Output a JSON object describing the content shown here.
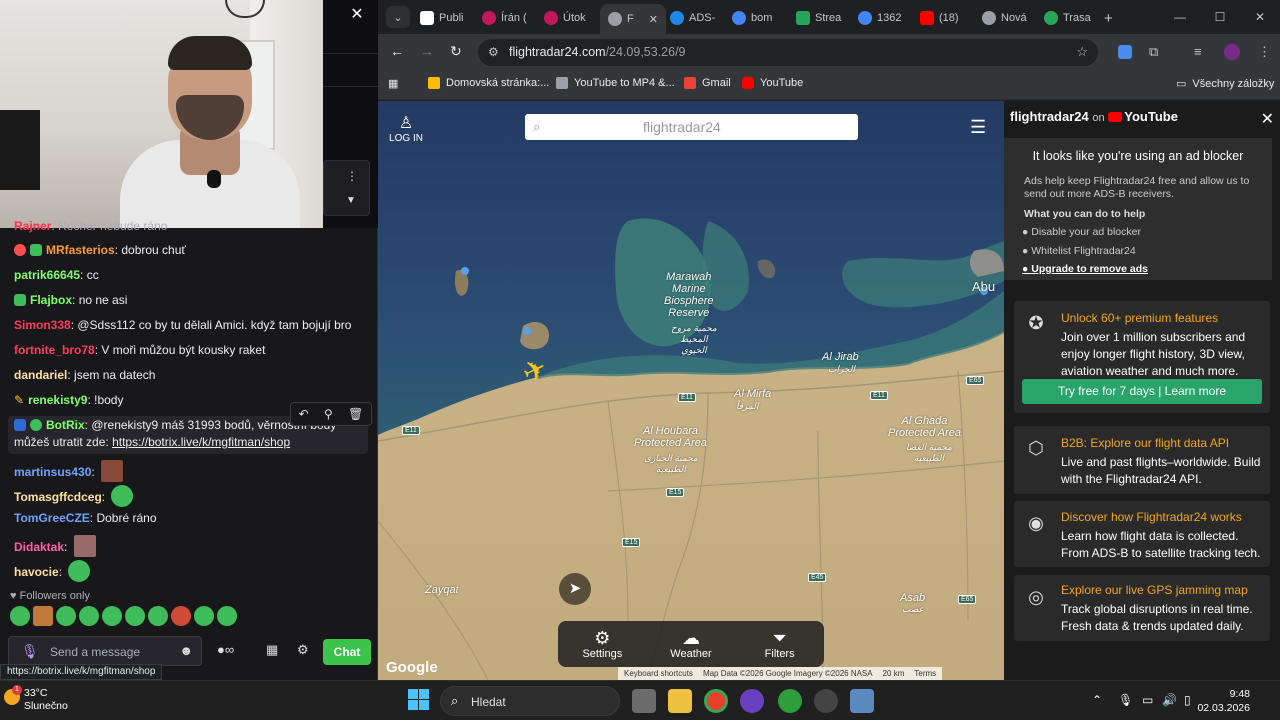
{
  "chat": {
    "close": "✕",
    "messages": [
      {
        "user": "MRfasterios",
        "color": "#ff7f00",
        "text": "dobrou chuť"
      },
      {
        "user": "patrik66645",
        "color": "#7fff00",
        "text": "cc"
      },
      {
        "user": "Flajbox",
        "color": "#7fff00",
        "text": "no ne asi"
      },
      {
        "user": "Simon338",
        "color": "#ff2f4f",
        "text": "@Sdss112 co by tu dělali Amici. když tam bojují bro"
      },
      {
        "user": "fortnite_bro78",
        "color": "#ff2f4f",
        "text": "V moři můžou být kousky raket"
      },
      {
        "user": "dandariel",
        "color": "#ffd59b",
        "text": "jsem na datech"
      },
      {
        "user": "renekisty9",
        "color": "#7fff00",
        "text": "!body"
      },
      {
        "user": "BotRix",
        "color": "#7fff00",
        "text": "@renekisty9 máš 31993 bodů, věrnostní body můžeš utratit zde:",
        "link": "https://botrix.live/k/mgfitman/shop"
      },
      {
        "user": "martinsus430",
        "color": "#5b9bff",
        "text": ""
      },
      {
        "user": "Tomasgffcdceg",
        "color": "#ffd59b",
        "text": ""
      },
      {
        "user": "TomGreeCZE",
        "color": "#5b9bff",
        "text": "Dobré ráno"
      },
      {
        "user": "Didaktak",
        "color": "#ff69b4",
        "text": ""
      },
      {
        "user": "havocie",
        "color": "#ffd59b",
        "text": ""
      }
    ],
    "partial_top": "Rocher nebude ráno",
    "followers_only": "Followers only",
    "input_placeholder": "Send a message",
    "chat_button": "Chat",
    "status_url": "https://botrix.live/k/mgfitman/shop"
  },
  "browser": {
    "tabs": [
      {
        "label": "Publi",
        "color": "#ffffff"
      },
      {
        "label": "Írán (",
        "color": "#c2185b"
      },
      {
        "label": "Útok",
        "color": "#c2185b"
      },
      {
        "label": "F",
        "color": "#9aa0a6",
        "active": true
      },
      {
        "label": "ADS-",
        "color": "#1e88e5"
      },
      {
        "label": "bom",
        "color": "#4285f4"
      },
      {
        "label": "Strea",
        "color": "#26a65b"
      },
      {
        "label": "1362",
        "color": "#4285f4"
      },
      {
        "label": "(18)",
        "color": "#ff0000"
      },
      {
        "label": "Nová",
        "color": "#9aa0a6"
      },
      {
        "label": "Trasa",
        "color": "#26a65b"
      }
    ],
    "url_host": "flightradar24.com",
    "url_path": "/24.09,53.26/9",
    "bookmarks": [
      {
        "label": "Domovská stránka:...",
        "color": "#fbbc05"
      },
      {
        "label": "YouTube to MP4 &...",
        "color": "#9aa0a6"
      },
      {
        "label": "Gmail",
        "color": "#ea4335"
      },
      {
        "label": "YouTube",
        "color": "#ff0000"
      }
    ],
    "all_bookmarks": "Všechny záložky"
  },
  "map": {
    "login": "LOG IN",
    "search_logo": "flightradar24",
    "labels": {
      "marawah": "Marawah\nMarine\nBiosphere\nReserve",
      "marawah_ar": "محمية مروح\nالمحيط\nالحيوي",
      "al_jirab": "Al Jirab",
      "al_jirab_ar": "الجراب",
      "al_mirfa": "Al Mirfa",
      "al_mirfa_ar": "المرفأ",
      "al_houbara": "Al Houbara\nProtected Area",
      "al_houbara_ar": "محمية الحبارى\nالطبيعية",
      "al_ghada": "Al Ghada\nProtected Area",
      "al_ghada_ar": "محمية الغضا\nالطبيعية",
      "zayqat": "Zayqat",
      "asab": "Asab",
      "asab_ar": "عصب",
      "abu": "Abu"
    },
    "roads": [
      "E11",
      "E11",
      "E11",
      "E65",
      "E15",
      "E15",
      "E45",
      "E65"
    ],
    "buttons": {
      "settings": "Settings",
      "weather": "Weather",
      "filters": "Filters"
    },
    "google": "Google",
    "attribution": {
      "shortcuts": "Keyboard shortcuts",
      "data": "Map Data ©2026 Google Imagery ©2026 NASA",
      "scale": "20 km",
      "terms": "Terms"
    }
  },
  "sidebar": {
    "brand": "flightradar24",
    "on": "on",
    "youtube": "YouTube",
    "adblock_title": "It looks like you're using an ad blocker",
    "adblock_text": "Ads help keep Flightradar24 free and allow us to send out more ADS-B receivers.",
    "what_you_can_do": "What you can do to help",
    "options": [
      "Disable your ad blocker",
      "Whitelist Flightradar24",
      "Upgrade to remove ads"
    ],
    "cards": [
      {
        "title": "Unlock 60+ premium features",
        "text": "Join over 1 million subscribers and enjoy longer flight history, 3D view, aviation weather and much more."
      },
      {
        "title": "B2B: Explore our flight data API",
        "text": "Live and past flights–worldwide. Build with the Flightradar24 API."
      },
      {
        "title": "Discover how Flightradar24 works",
        "text": "Learn how flight data is collected. From ADS-B to satellite tracking tech."
      },
      {
        "title": "Explore our live GPS jamming map",
        "text": "Track global disruptions in real time. Fresh data & trends updated daily."
      }
    ],
    "try_button": "Try free for 7 days  |  Learn more"
  },
  "taskbar": {
    "temp": "33°C",
    "weather": "Slunečno",
    "weather_badge": "1",
    "search": "Hledat",
    "time": "9:48",
    "date": "02.03.2026"
  }
}
